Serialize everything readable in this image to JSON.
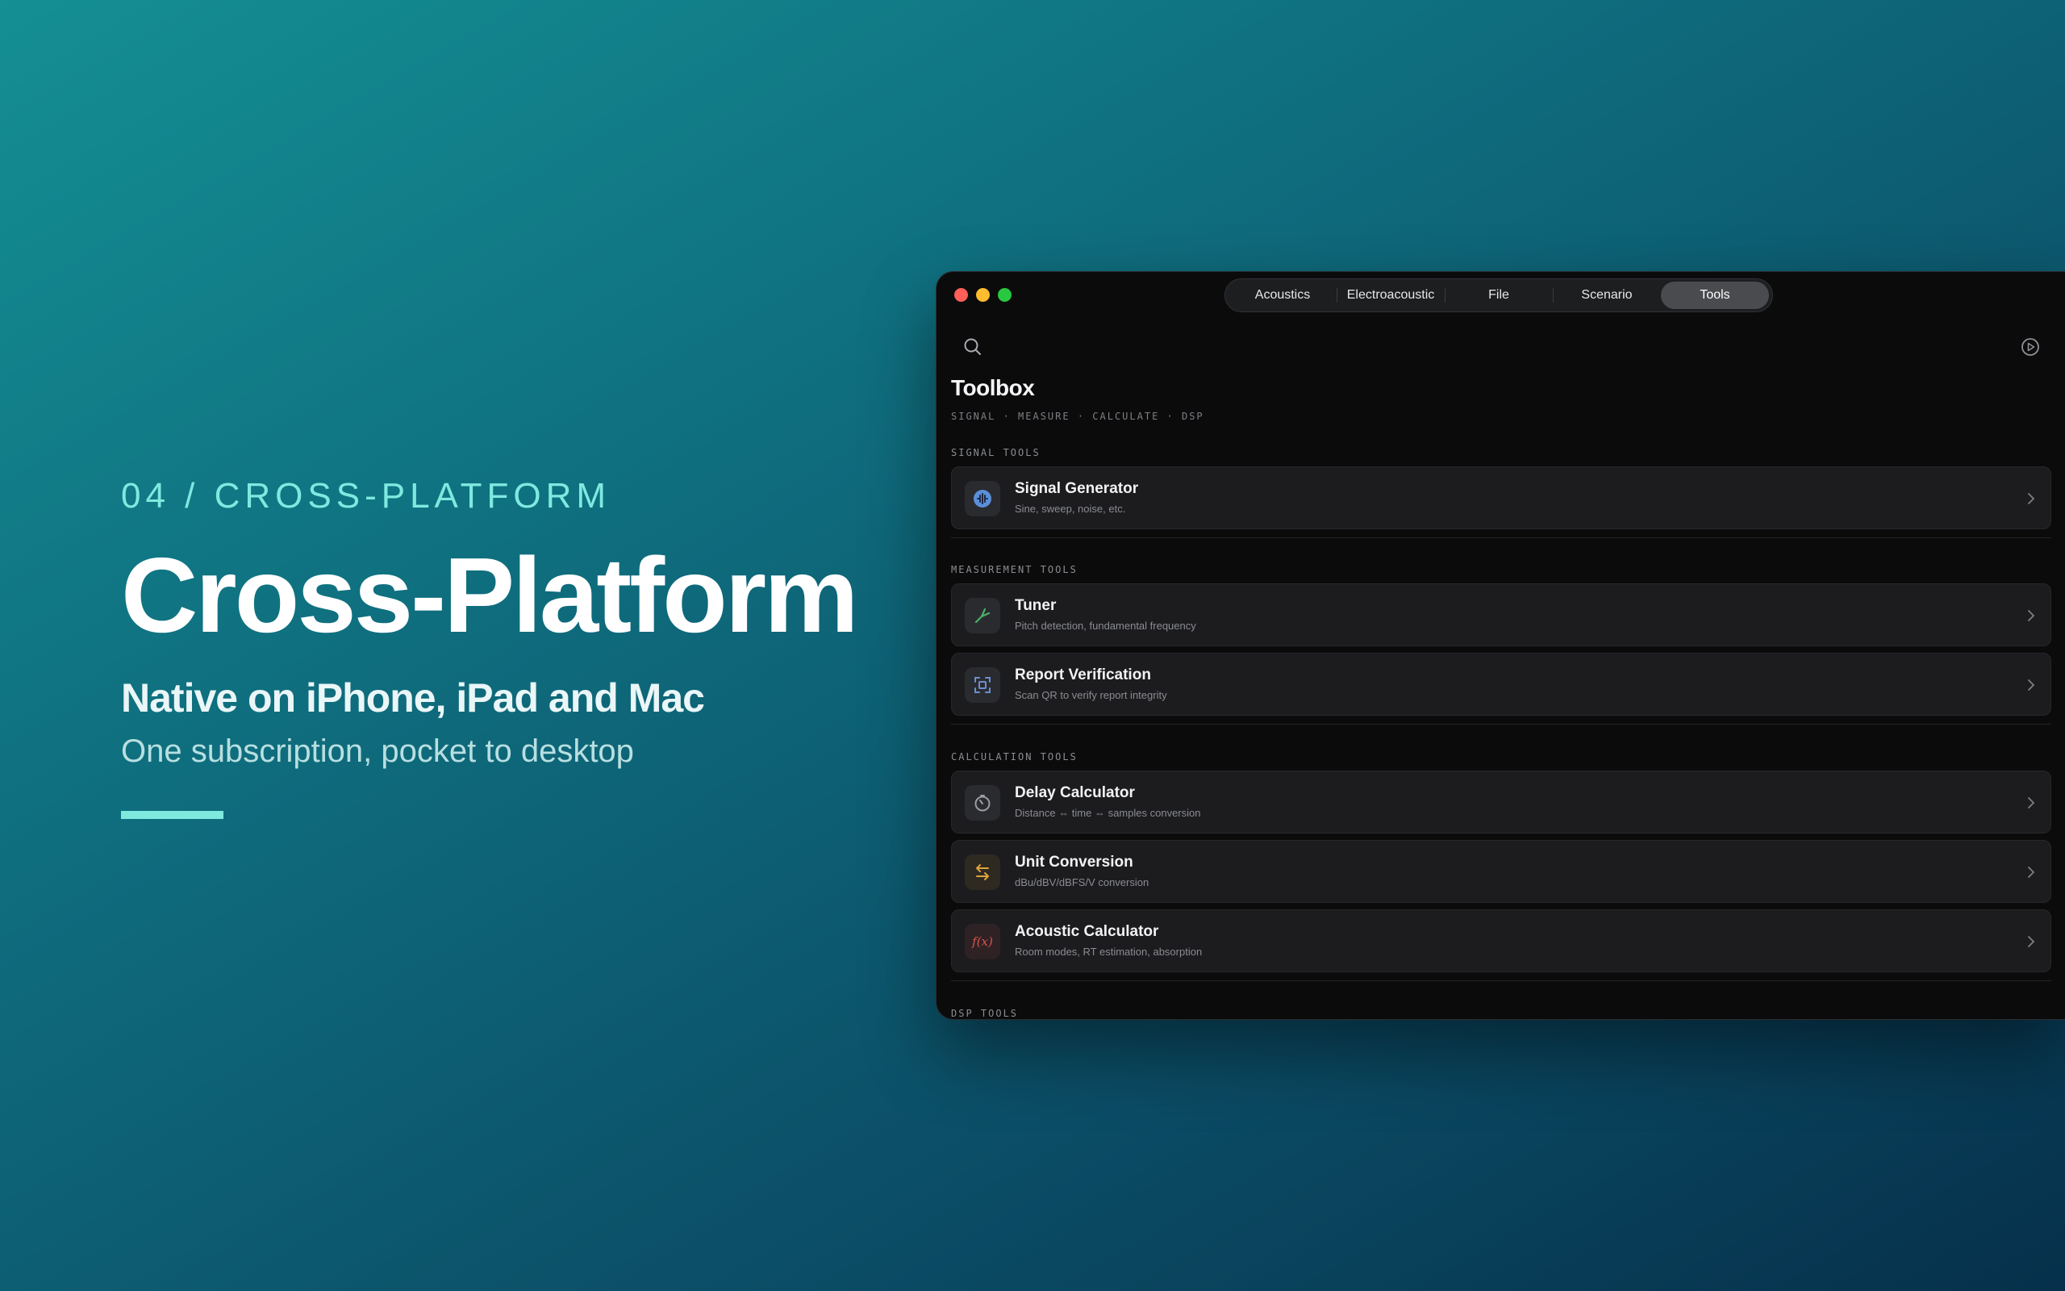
{
  "hero": {
    "eyebrow": "04 / CROSS-PLATFORM",
    "headline": "Cross-Platform",
    "subhead": "Native on iPhone, iPad and Mac",
    "tagline": "One subscription, pocket to desktop",
    "accent_color": "#7fe9e0"
  },
  "window": {
    "tabs": [
      {
        "label": "Acoustics",
        "active": false
      },
      {
        "label": "Electroacoustic",
        "active": false
      },
      {
        "label": "File",
        "active": false
      },
      {
        "label": "Scenario",
        "active": false
      },
      {
        "label": "Tools",
        "active": true
      }
    ],
    "toolbar": {
      "search_icon": "search-icon",
      "play_icon": "play-circle-icon"
    },
    "title": "Toolbox",
    "subtitle": "SIGNAL · MEASURE · CALCULATE · DSP",
    "sections": [
      {
        "label": "SIGNAL TOOLS",
        "items": [
          {
            "title": "Signal Generator",
            "desc": "Sine, sweep, noise, etc.",
            "icon": "waveform-icon",
            "icon_color": "#5b8fd9"
          }
        ]
      },
      {
        "label": "MEASUREMENT TOOLS",
        "items": [
          {
            "title": "Tuner",
            "desc": "Pitch detection, fundamental frequency",
            "icon": "tuning-fork-icon",
            "icon_color": "#4caf6a"
          },
          {
            "title": "Report Verification",
            "desc": "Scan QR to verify report integrity",
            "icon": "qr-scan-icon",
            "icon_color": "#6b8fd0"
          }
        ]
      },
      {
        "label": "CALCULATION TOOLS",
        "items": [
          {
            "title": "Delay Calculator",
            "desc": "Distance ⇔ time ⇔ samples conversion",
            "icon": "timer-icon",
            "icon_color": "#9a9ca2"
          },
          {
            "title": "Unit Conversion",
            "desc": "dBu/dBV/dBFS/V conversion",
            "icon": "swap-arrows-icon",
            "icon_color": "#e0a23a"
          },
          {
            "title": "Acoustic Calculator",
            "desc": "Room modes, RT estimation, absorption",
            "icon": "function-icon",
            "icon_color": "#d9534f"
          }
        ]
      },
      {
        "label": "DSP TOOLS",
        "items": []
      }
    ]
  }
}
